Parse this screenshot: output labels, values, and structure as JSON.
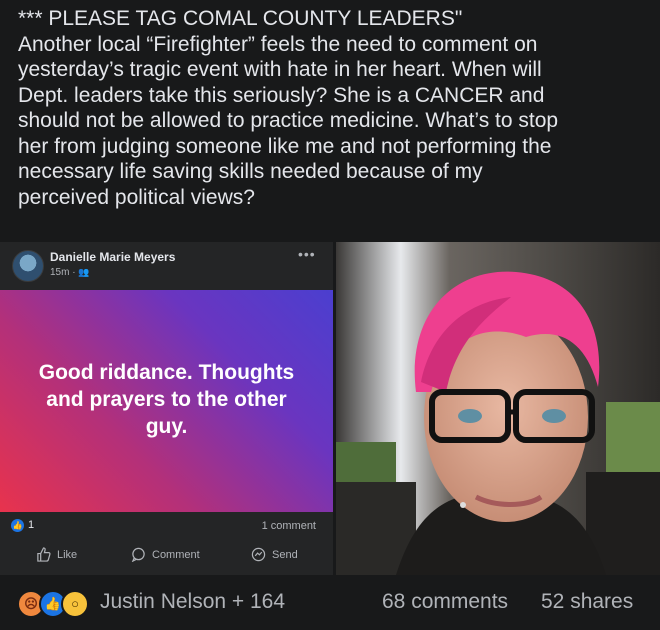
{
  "post": {
    "text_lines": [
      "*** PLEASE TAG COMAL COUNTY LEADERS\"",
      "Another local “Firefighter” feels the need to comment on",
      "yesterday’s tragic event with hate in her heart. When will",
      "Dept. leaders take this seriously? She is a CANCER and",
      "should not be allowed to practice medicine. What’s to stop",
      "her from judging someone like me and not performing the",
      "necessary life saving skills needed because of my",
      "perceived political views?"
    ]
  },
  "embedded_post": {
    "author": "Danielle Marie Meyers",
    "time": "15m ·",
    "more_icon": "more-dots-icon",
    "banner_text": "Good riddance. Thoughts and prayers to the other guy.",
    "banner_colors": [
      "#e8334d",
      "#b3307a",
      "#6a35c0",
      "#4b3fcf"
    ],
    "like_count": "1",
    "comment_count": "1 comment",
    "actions": {
      "like": "Like",
      "comment": "Comment",
      "send": "Send"
    }
  },
  "footer": {
    "reactions": [
      "angry",
      "like",
      "wow"
    ],
    "reactors": "Justin Nelson + 164",
    "comments": "68 comments",
    "shares": "52 shares"
  },
  "colors": {
    "background": "#18191a",
    "text": "#e4e6eb",
    "secondary": "#b0b3b8",
    "accent": "#1b74e4"
  }
}
